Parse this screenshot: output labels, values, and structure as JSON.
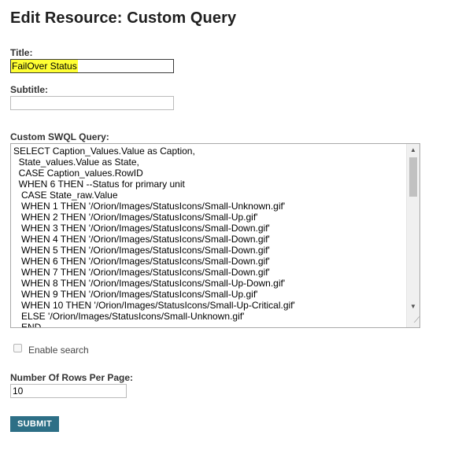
{
  "page": {
    "title": "Edit Resource: Custom Query"
  },
  "form": {
    "title_label": "Title:",
    "title_value": "FailOver Status",
    "subtitle_label": "Subtitle:",
    "subtitle_value": "",
    "query_label": "Custom SWQL Query:",
    "query_lines": [
      "SELECT Caption_Values.Value as Caption,",
      "  State_values.Value as State,",
      "  CASE Caption_values.RowID",
      "  WHEN 6 THEN --Status for primary unit",
      "   CASE State_raw.Value",
      "   WHEN 1 THEN '/Orion/Images/StatusIcons/Small-Unknown.gif'",
      "   WHEN 2 THEN '/Orion/Images/StatusIcons/Small-Up.gif'",
      "   WHEN 3 THEN '/Orion/Images/StatusIcons/Small-Down.gif'",
      "   WHEN 4 THEN '/Orion/Images/StatusIcons/Small-Down.gif'",
      "   WHEN 5 THEN '/Orion/Images/StatusIcons/Small-Down.gif'",
      "   WHEN 6 THEN '/Orion/Images/StatusIcons/Small-Down.gif'",
      "   WHEN 7 THEN '/Orion/Images/StatusIcons/Small-Down.gif'",
      "   WHEN 8 THEN '/Orion/Images/StatusIcons/Small-Up-Down.gif'",
      "   WHEN 9 THEN '/Orion/Images/StatusIcons/Small-Up.gif'",
      "   WHEN 10 THEN '/Orion/Images/StatusIcons/Small-Up-Critical.gif'",
      "   ELSE '/Orion/Images/StatusIcons/Small-Unknown.gif'",
      "   END"
    ],
    "enable_search_label": "Enable search",
    "enable_search_checked": false,
    "rows_label": "Number Of Rows Per Page:",
    "rows_value": "10",
    "submit_label": "SUBMIT"
  },
  "colors": {
    "submit_bg": "#2d6f86",
    "title_highlight": "#ffff33"
  },
  "icons": {
    "scroll_up": "triangle-up",
    "scroll_down": "triangle-down",
    "resize": "resize-grip"
  }
}
